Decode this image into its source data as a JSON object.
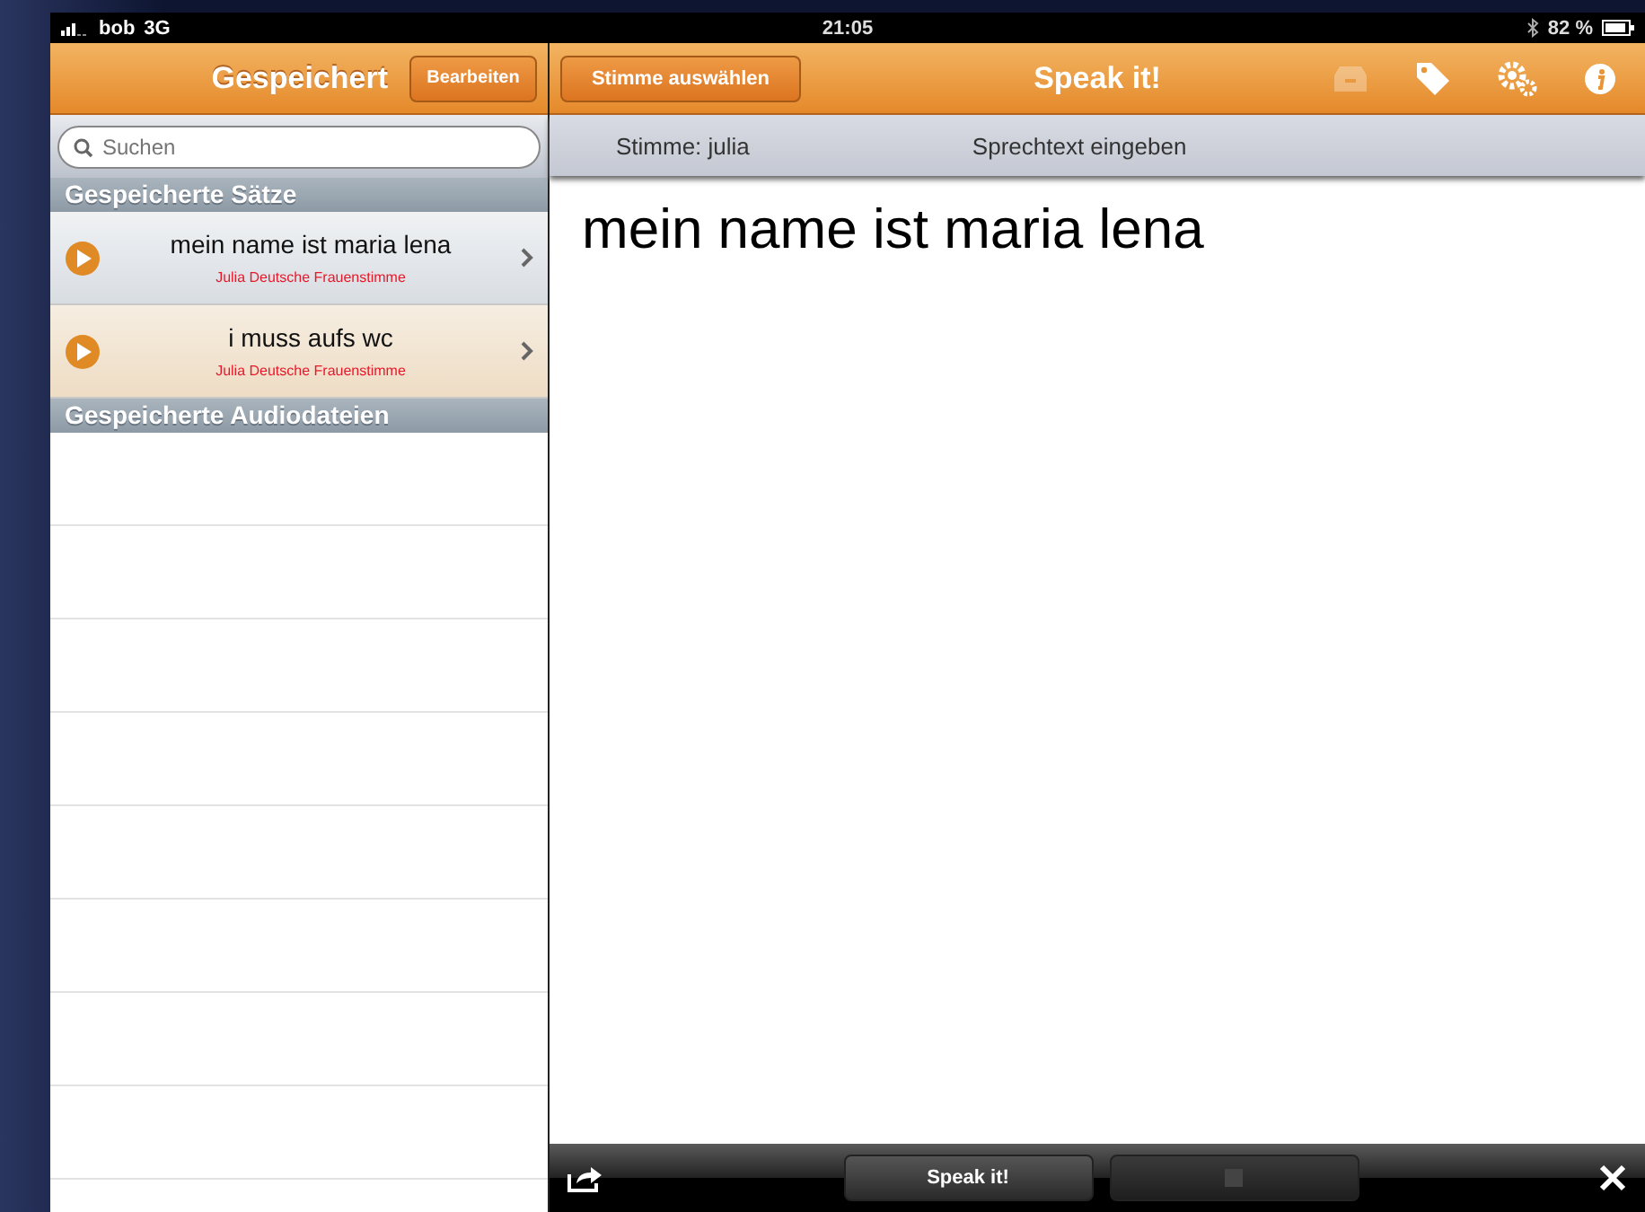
{
  "status_bar": {
    "carrier": "bob",
    "network": "3G",
    "time": "21:05",
    "battery": "82 %"
  },
  "sidebar": {
    "title": "Gespeichert",
    "edit_button": "Bearbeiten",
    "search": {
      "placeholder": "Suchen"
    },
    "sections": [
      {
        "title": "Gespeicherte Sätze",
        "items": [
          {
            "text": "mein name ist maria lena",
            "voice": "Julia Deutsche Frauenstimme",
            "selected": false
          },
          {
            "text": "i muss aufs wc",
            "voice": "Julia Deutsche Frauenstimme",
            "selected": true
          }
        ]
      },
      {
        "title": "Gespeicherte Audiodateien"
      }
    ]
  },
  "main": {
    "voice_button": "Stimme auswählen",
    "title": "Speak it!",
    "toolbar_icons": [
      {
        "kind": "archive",
        "disabled": true
      },
      {
        "kind": "tag",
        "disabled": false
      },
      {
        "kind": "settings",
        "disabled": false
      },
      {
        "kind": "info",
        "disabled": false
      }
    ],
    "voice_label": "Stimme: julia",
    "input_hint": "Sprechtext eingeben",
    "text": "mein name ist maria lena",
    "bottom": {
      "speak_button": "Speak it!",
      "stop_disabled": true
    }
  }
}
